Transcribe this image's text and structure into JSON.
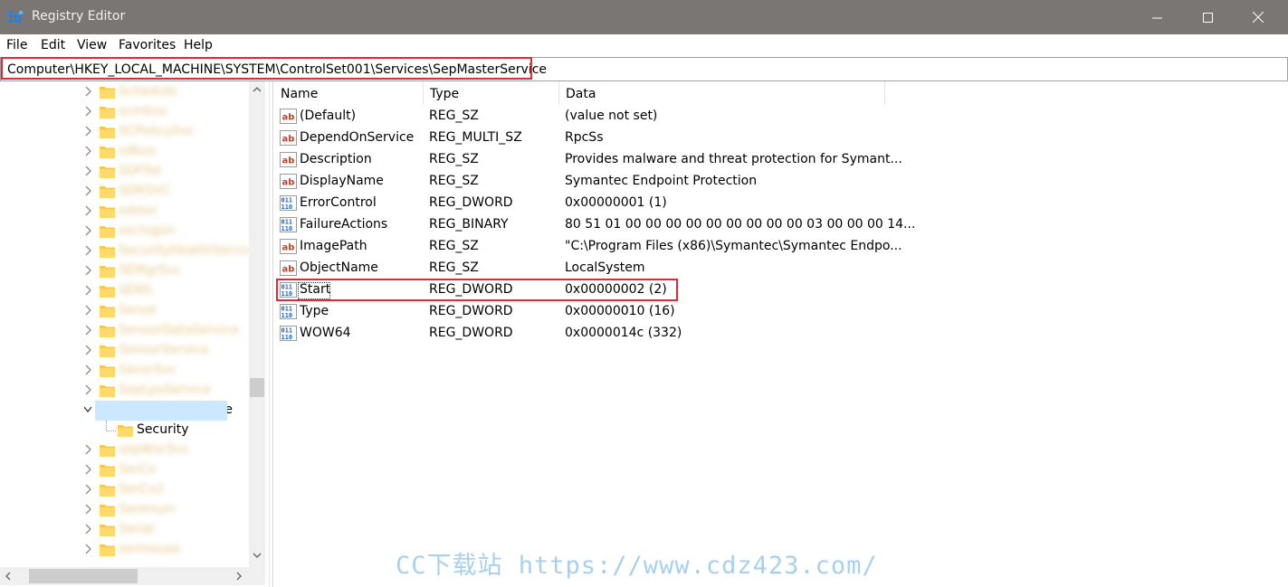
{
  "window": {
    "title": "Registry Editor",
    "app_icon": "regedit-icon",
    "controls": {
      "minimize": "minimize-icon",
      "maximize": "maximize-icon",
      "close": "close-icon"
    }
  },
  "menu": [
    "File",
    "Edit",
    "View",
    "Favorites",
    "Help"
  ],
  "address": {
    "path": "Computer\\HKEY_LOCAL_MACHINE\\SYSTEM\\ControlSet001\\Services\\SepMasterService"
  },
  "tree": {
    "blurred_above": [
      "Schedule",
      "scmbus",
      "SCPolicySvc",
      "sdbus",
      "SDFRd",
      "SDRSVC",
      "sdstor",
      "seclogon",
      "SecurityHealthService",
      "SEMgrSvc",
      "SENS",
      "Sense",
      "SensorDataService",
      "SensorService",
      "SensrSvc",
      "SepLpsService"
    ],
    "selected": "SepMasterService",
    "child": "Security",
    "blurred_below": [
      "sepWscSvc",
      "SerCx",
      "SerCx2",
      "Serenum",
      "Serial",
      "sermouse"
    ]
  },
  "columns": {
    "name": "Name",
    "type": "Type",
    "data": "Data"
  },
  "values": [
    {
      "name": "(Default)",
      "type": "REG_SZ",
      "data": "(value not set)",
      "icon": "string-value-icon"
    },
    {
      "name": "DependOnService",
      "type": "REG_MULTI_SZ",
      "data": "RpcSs",
      "icon": "string-value-icon"
    },
    {
      "name": "Description",
      "type": "REG_SZ",
      "data": "Provides malware and threat protection for Symant...",
      "icon": "string-value-icon"
    },
    {
      "name": "DisplayName",
      "type": "REG_SZ",
      "data": "Symantec Endpoint Protection",
      "icon": "string-value-icon"
    },
    {
      "name": "ErrorControl",
      "type": "REG_DWORD",
      "data": "0x00000001 (1)",
      "icon": "binary-value-icon"
    },
    {
      "name": "FailureActions",
      "type": "REG_BINARY",
      "data": "80 51 01 00 00 00 00 00 00 00 00 00 03 00 00 00 14...",
      "icon": "binary-value-icon"
    },
    {
      "name": "ImagePath",
      "type": "REG_SZ",
      "data": "\"C:\\Program Files (x86)\\Symantec\\Symantec Endpo...",
      "icon": "string-value-icon"
    },
    {
      "name": "ObjectName",
      "type": "REG_SZ",
      "data": "LocalSystem",
      "icon": "string-value-icon"
    },
    {
      "name": "Start",
      "type": "REG_DWORD",
      "data": "0x00000002 (2)",
      "icon": "binary-value-icon"
    },
    {
      "name": "Type",
      "type": "REG_DWORD",
      "data": "0x00000010 (16)",
      "icon": "binary-value-icon"
    },
    {
      "name": "WOW64",
      "type": "REG_DWORD",
      "data": "0x0000014c (332)",
      "icon": "binary-value-icon"
    }
  ],
  "watermark": "CC下载站 https://www.cdz423.com/",
  "colors": {
    "titlebar": "#797674",
    "highlight": "#e02a35",
    "selection": "#cce8ff",
    "folder": "#f5c84c"
  }
}
